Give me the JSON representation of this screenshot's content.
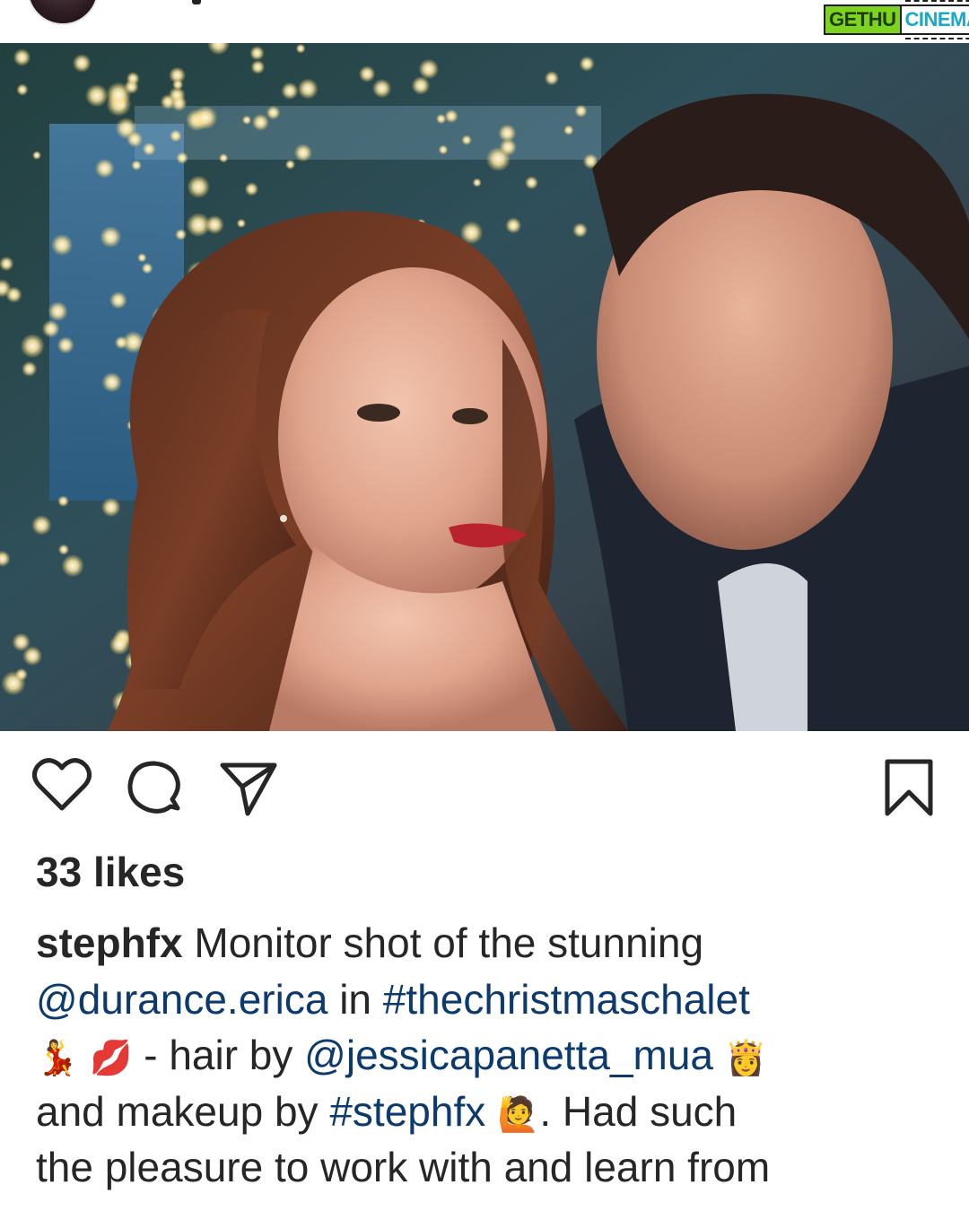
{
  "watermark": {
    "part1": "GETHU",
    "part2": "CINEMA"
  },
  "post": {
    "likes_label": "33 likes",
    "caption": {
      "username": "stephfx",
      "line1_text": " Monitor shot of the stunning",
      "mention1": "@durance.erica",
      "line2_mid": " in ",
      "hashtag1": "#thechristmaschalet",
      "emoji_dancer": "💃",
      "emoji_kiss": "💋",
      "line3_text": " - hair by ",
      "mention2": "@jessicapanetta_mua",
      "emoji_princess": "👸",
      "line4_text": "and makeup by ",
      "hashtag2": "#stephfx",
      "emoji_raise": "🙋",
      "line4_end": ". Had such",
      "line5_text": "the pleasure to work with and learn from"
    }
  },
  "icons": {
    "like": "heart-icon",
    "comment": "comment-icon",
    "share": "paper-plane-icon",
    "save": "bookmark-icon"
  },
  "colors": {
    "text": "#262626",
    "link": "#0d3a6e",
    "background": "#ffffff"
  }
}
